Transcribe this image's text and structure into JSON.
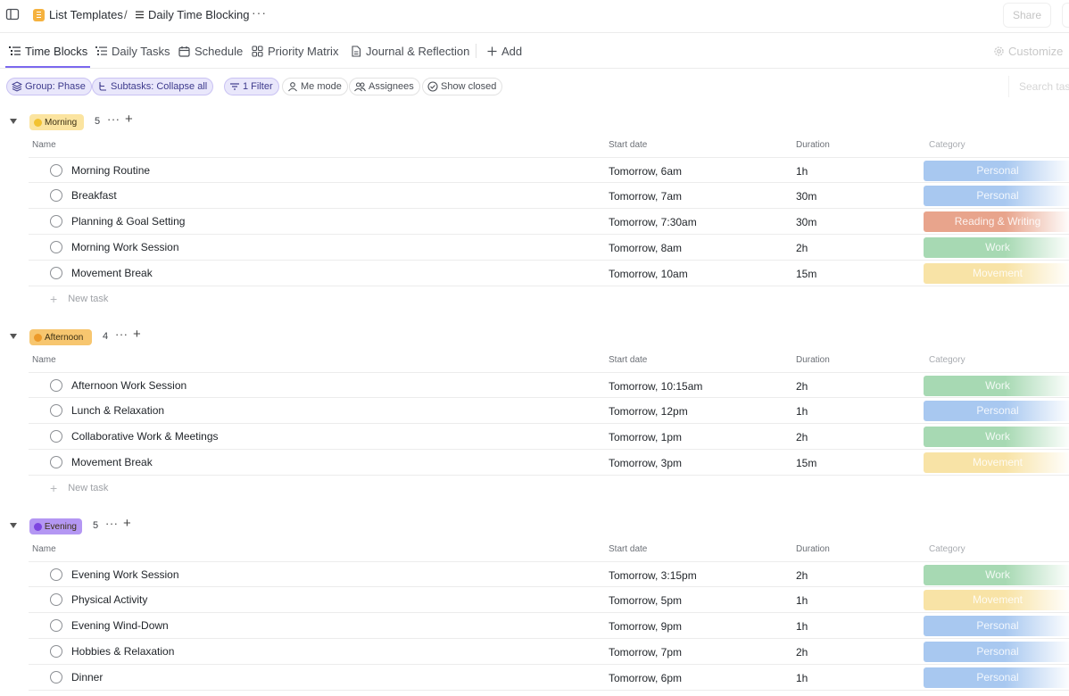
{
  "breadcrumb": {
    "space": "List Templates",
    "separator": "/",
    "list": "Daily Time Blocking",
    "more": "···"
  },
  "header": {
    "share_label": "Share"
  },
  "tabs": [
    {
      "label": "Time Blocks",
      "icon": "list-view-icon",
      "active": true
    },
    {
      "label": "Daily Tasks",
      "icon": "list-view-icon",
      "active": false
    },
    {
      "label": "Schedule",
      "icon": "calendar-icon",
      "active": false
    },
    {
      "label": "Priority Matrix",
      "icon": "board-icon",
      "active": false
    },
    {
      "label": "Journal & Reflection",
      "icon": "doc-icon",
      "active": false
    }
  ],
  "add_view_label": "Add",
  "customize_label": "Customize",
  "filters": {
    "group": "Group: Phase",
    "subtasks": "Subtasks: Collapse all",
    "filter": "1 Filter",
    "me_mode": "Me mode",
    "assignees": "Assignees",
    "show_closed": "Show closed",
    "search_placeholder": "Search tasks..."
  },
  "columns": {
    "name": "Name",
    "start_date": "Start date",
    "duration": "Duration",
    "category": "Category"
  },
  "new_task_label": "New task",
  "colors": {
    "accent": "#7b68ee",
    "Personal": "#a8c8f0",
    "Work": "#a7d9b3",
    "Reading & Writing": "#e8a48c",
    "Movement": "#f8e3a6",
    "morning": "#f6d77a",
    "afternoon": "#f5c46a",
    "evening": "#a685f0"
  },
  "groups": [
    {
      "label": "Morning",
      "count": "5",
      "color": "#fbe4a0",
      "dot": "#f2c232",
      "tasks": [
        {
          "name": "Morning Routine",
          "start": "Tomorrow, 6am",
          "duration": "1h",
          "category": "Personal"
        },
        {
          "name": "Breakfast",
          "start": "Tomorrow, 7am",
          "duration": "30m",
          "category": "Personal"
        },
        {
          "name": "Planning & Goal Setting",
          "start": "Tomorrow, 7:30am",
          "duration": "30m",
          "category": "Reading & Writing"
        },
        {
          "name": "Morning Work Session",
          "start": "Tomorrow, 8am",
          "duration": "2h",
          "category": "Work"
        },
        {
          "name": "Movement Break",
          "start": "Tomorrow, 10am",
          "duration": "15m",
          "category": "Movement"
        }
      ]
    },
    {
      "label": "Afternoon",
      "count": "4",
      "color": "#f7c66f",
      "dot": "#ec9a2a",
      "tasks": [
        {
          "name": "Afternoon Work Session",
          "start": "Tomorrow, 10:15am",
          "duration": "2h",
          "category": "Work"
        },
        {
          "name": "Lunch & Relaxation",
          "start": "Tomorrow, 12pm",
          "duration": "1h",
          "category": "Personal"
        },
        {
          "name": "Collaborative Work & Meetings",
          "start": "Tomorrow, 1pm",
          "duration": "2h",
          "category": "Work"
        },
        {
          "name": "Movement Break",
          "start": "Tomorrow, 3pm",
          "duration": "15m",
          "category": "Movement"
        }
      ]
    },
    {
      "label": "Evening",
      "count": "5",
      "color": "#b497f3",
      "dot": "#7d45e0",
      "tasks": [
        {
          "name": "Evening Work Session",
          "start": "Tomorrow, 3:15pm",
          "duration": "2h",
          "category": "Work"
        },
        {
          "name": "Physical Activity",
          "start": "Tomorrow, 5pm",
          "duration": "1h",
          "category": "Movement"
        },
        {
          "name": "Evening Wind-Down",
          "start": "Tomorrow, 9pm",
          "duration": "1h",
          "category": "Personal"
        },
        {
          "name": "Hobbies & Relaxation",
          "start": "Tomorrow, 7pm",
          "duration": "2h",
          "category": "Personal"
        },
        {
          "name": "Dinner",
          "start": "Tomorrow, 6pm",
          "duration": "1h",
          "category": "Personal"
        }
      ]
    }
  ]
}
